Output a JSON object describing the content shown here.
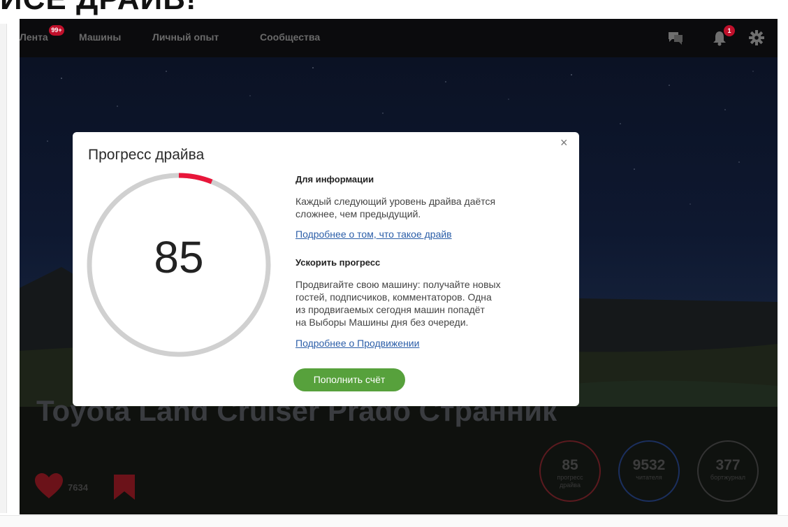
{
  "page_heading_cut": "ИСЕ ДРАЙВ!",
  "nav": {
    "items": [
      {
        "label": "Лента",
        "badge": "99+"
      },
      {
        "label": "Машины"
      },
      {
        "label": "Личный опыт"
      },
      {
        "label": "Сообщества"
      }
    ],
    "bell_badge": "1"
  },
  "car": {
    "title": "Toyota Land Cruiser Prado Странник",
    "likes": "7634"
  },
  "stats": [
    {
      "value": "85",
      "label_1": "прогресс",
      "label_2": "драйва"
    },
    {
      "value": "9532",
      "label_1": "читателя",
      "label_2": ""
    },
    {
      "value": "377",
      "label_1": "бортжурнал",
      "label_2": ""
    }
  ],
  "modal": {
    "title": "Прогресс драйва",
    "close": "×",
    "drive_level": "85",
    "progress_to_next_level": 0.06,
    "progress_color": "#e8163a",
    "info_heading": "Для информации",
    "info_text_1": "Каждый следующий уровень драйва даётся",
    "info_text_2": "сложнее, чем предыдущий.",
    "info_link": "Подробнее о том, что такое драйв",
    "boost_heading": "Ускорить прогресс",
    "boost_text_1": "Продвигайте свою машину: получайте новых",
    "boost_text_2": "гостей, подписчиков, комментаторов. Одна",
    "boost_text_3": "из продвигаемых сегодня машин попадёт",
    "boost_text_4": "на Выборы Машины дня без очереди.",
    "boost_link": "Подробнее о Продвижении",
    "button": "Пополнить счёт"
  }
}
